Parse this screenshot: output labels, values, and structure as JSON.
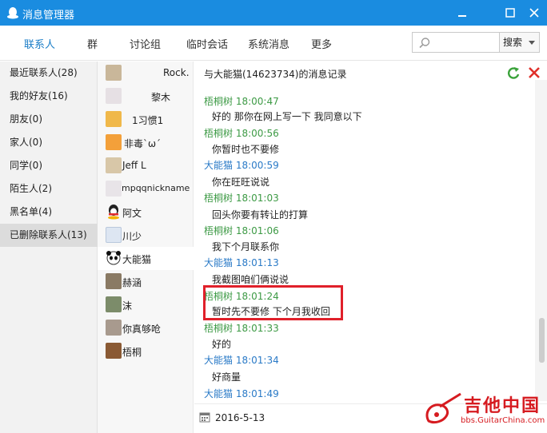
{
  "window": {
    "title": "消息管理器"
  },
  "tabs": [
    {
      "label": "联系人",
      "active": true
    },
    {
      "label": "群",
      "active": false
    },
    {
      "label": "讨论组",
      "active": false
    },
    {
      "label": "临时会话",
      "active": false
    },
    {
      "label": "系统消息",
      "active": false
    },
    {
      "label": "更多",
      "active": false
    }
  ],
  "search": {
    "placeholder": "",
    "button_label": "搜索"
  },
  "categories": [
    {
      "label": "最近联系人(28)"
    },
    {
      "label": "我的好友(16)"
    },
    {
      "label": "朋友(0)"
    },
    {
      "label": "家人(0)"
    },
    {
      "label": "同学(0)"
    },
    {
      "label": "陌生人(2)"
    },
    {
      "label": "黑名单(4)"
    },
    {
      "label": "已删除联系人(13)",
      "selected": true
    }
  ],
  "contacts": [
    {
      "name": "Rock."
    },
    {
      "name": "黎木"
    },
    {
      "name": "1习惯1"
    },
    {
      "name": "非毒`ω´"
    },
    {
      "name": "Jeff L"
    },
    {
      "name": "mpqqnickname"
    },
    {
      "name": "阿文"
    },
    {
      "name": "川少"
    },
    {
      "name": "大能猫",
      "selected": true
    },
    {
      "name": "赫涵"
    },
    {
      "name": "沫"
    },
    {
      "name": "你真够呛"
    },
    {
      "name": "梧桐"
    }
  ],
  "chat": {
    "header": "与大能猫(14623734)的消息记录",
    "messages": [
      {
        "sender": "梧桐树",
        "time": "18:00:47",
        "text": "好的 那你在网上写一下 我同意以下",
        "side": "me"
      },
      {
        "sender": "梧桐树",
        "time": "18:00:56",
        "text": "你暂时也不要修",
        "side": "me"
      },
      {
        "sender": "大能猫",
        "time": "18:00:59",
        "text": "你在旺旺说说",
        "side": "other"
      },
      {
        "sender": "梧桐树",
        "time": "18:01:03",
        "text": "回头你要有转让的打算",
        "side": "me"
      },
      {
        "sender": "梧桐树",
        "time": "18:01:06",
        "text": "我下个月联系你",
        "side": "me"
      },
      {
        "sender": "大能猫",
        "time": "18:01:13",
        "text": "我截图咱们俩说说",
        "side": "other"
      },
      {
        "sender": "梧桐树",
        "time": "18:01:24",
        "text": "暂时先不要修 下个月我收回",
        "side": "me"
      },
      {
        "sender": "梧桐树",
        "time": "18:01:33",
        "text": "好的",
        "side": "me"
      },
      {
        "sender": "大能猫",
        "time": "18:01:34",
        "text": "好商量",
        "side": "other"
      },
      {
        "sender": "大能猫",
        "time": "18:01:49",
        "text": "",
        "side": "other"
      }
    ]
  },
  "date_bar": {
    "date": "2016-5-13"
  },
  "watermark": {
    "title": "吉他中国",
    "subtitle": "bbs.GuitarChina.com"
  },
  "colors": {
    "titlebar": "#1a8ce0",
    "tab_active": "#1a7dc7",
    "sender_me": "#3d9a45",
    "sender_other": "#2a7ac7",
    "highlight": "#e0202a"
  }
}
